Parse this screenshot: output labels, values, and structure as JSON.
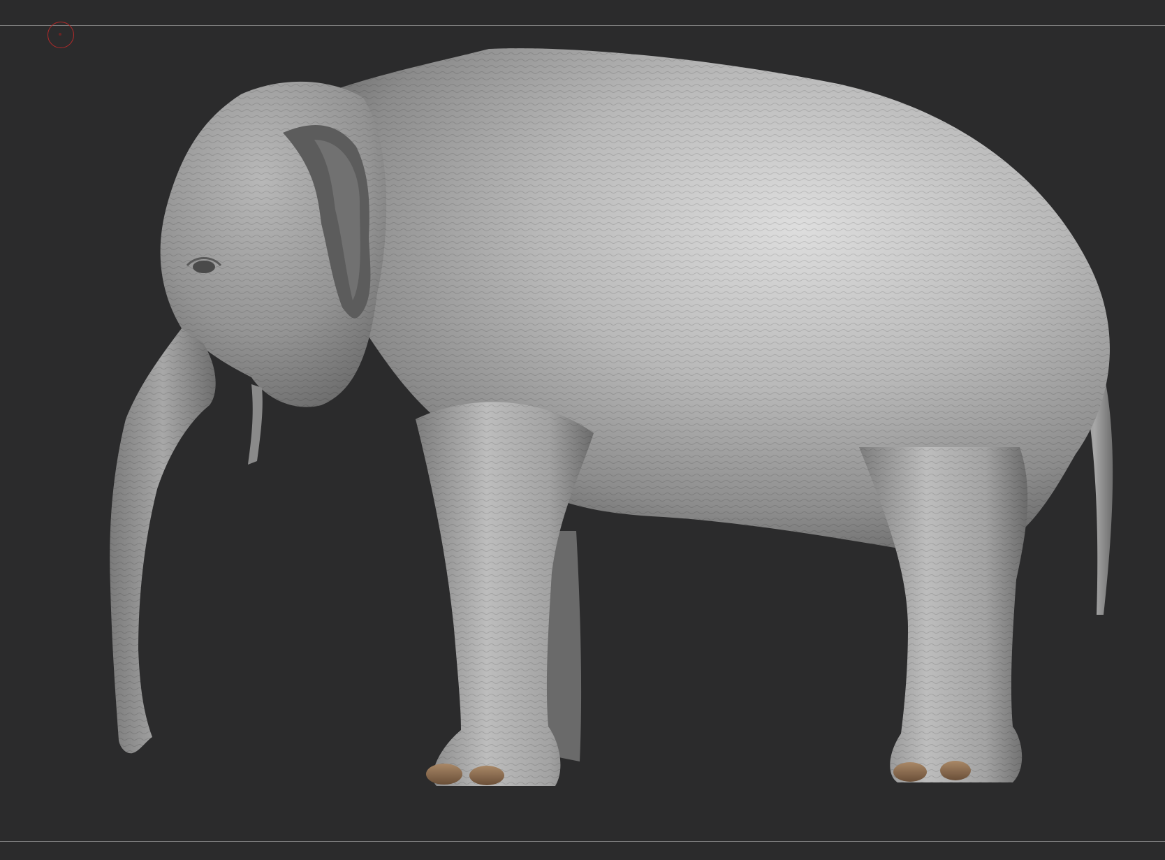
{
  "viewport": {
    "background_color": "#2b2b2c",
    "frame_line_color": "#7a7a7a"
  },
  "cursor": {
    "icon": "brush-cursor-icon",
    "color": "#b22a2a"
  },
  "model": {
    "subject": "elephant-sculpt",
    "material_color": "#9a9a9a",
    "toenail_color": "#8a6a4c"
  }
}
